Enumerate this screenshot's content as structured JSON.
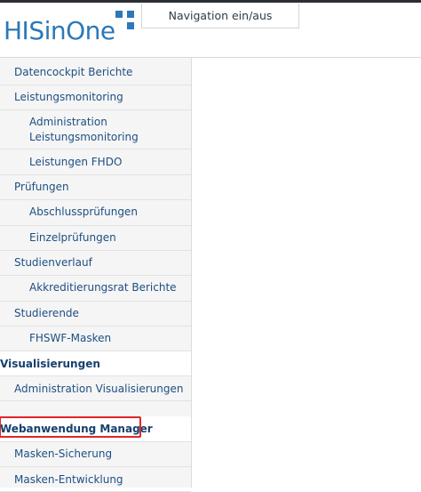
{
  "header": {
    "logo_text": "HISinOne",
    "nav_toggle_label": "Navigation ein/aus"
  },
  "sidebar": {
    "items": [
      {
        "label": "Datencockpit Berichte",
        "level": 1
      },
      {
        "label": "Leistungsmonitoring",
        "level": 1
      },
      {
        "label": "Administration Leistungsmonitoring",
        "level": 2
      },
      {
        "label": "Leistungen FHDO",
        "level": 2
      },
      {
        "label": "Prüfungen",
        "level": 1
      },
      {
        "label": "Abschlussprüfungen",
        "level": 2
      },
      {
        "label": "Einzelprüfungen",
        "level": 2
      },
      {
        "label": "Studienverlauf",
        "level": 1
      },
      {
        "label": "Akkreditierungsrat Berichte",
        "level": 2
      },
      {
        "label": "Studierende",
        "level": 1
      },
      {
        "label": "FHSWF-Masken",
        "level": 2
      },
      {
        "label": "Visualisierungen",
        "level": 0
      },
      {
        "label": "Administration Visualisierungen",
        "level": 1
      },
      {
        "label": "Webanwendung Manager",
        "level": 0
      },
      {
        "label": "Masken-Sicherung",
        "level": 1
      },
      {
        "label": "Masken-Entwicklung",
        "level": 1
      }
    ]
  },
  "colors": {
    "brand_blue": "#2c78b8",
    "link_blue": "#1d4f83",
    "highlight_red": "#e0262b"
  }
}
